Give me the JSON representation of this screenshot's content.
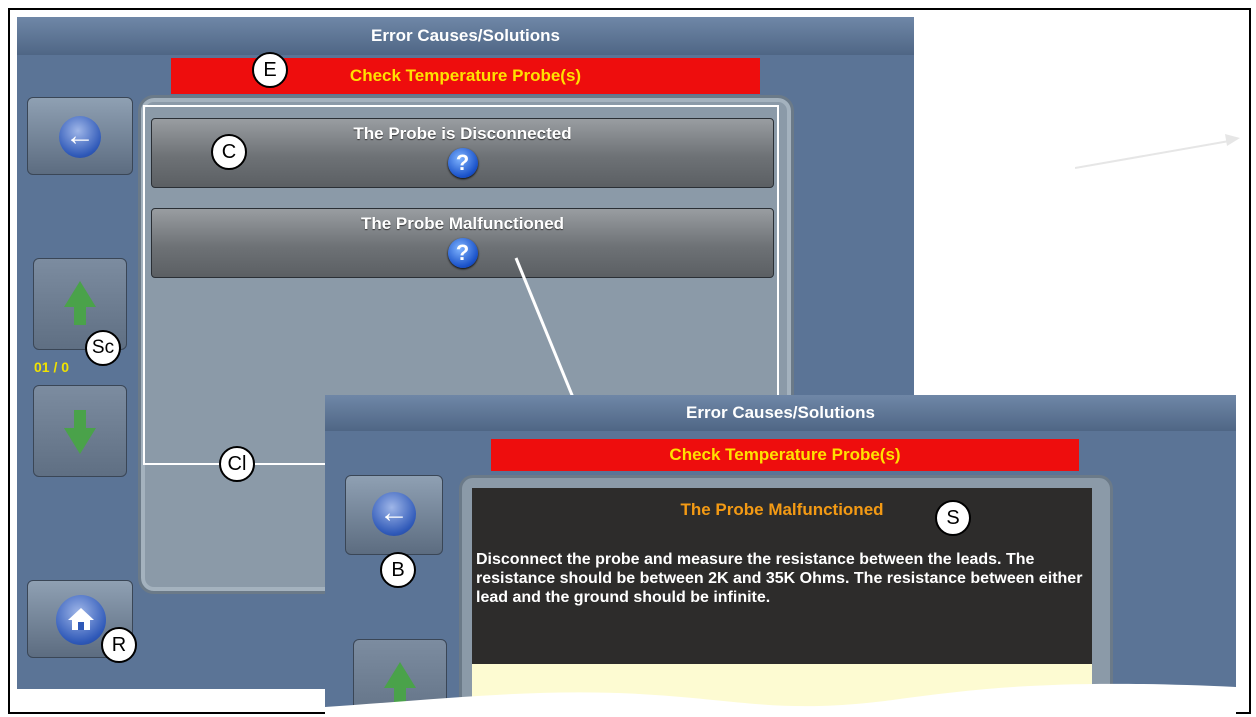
{
  "main_screen": {
    "title": "Error Causes/Solutions",
    "error_message": "Check Temperature Probe(s)",
    "causes": [
      {
        "label": "The Probe is Disconnected",
        "help_icon": "?"
      },
      {
        "label": "The Probe Malfunctioned",
        "help_icon": "?"
      }
    ],
    "pager": "01 / 0"
  },
  "inset_screen": {
    "title": "Error Causes/Solutions",
    "error_message": "Check Temperature Probe(s)",
    "solution_title": "The Probe Malfunctioned",
    "solution_text": "Disconnect the probe and measure the resistance between the leads. The resistance should be between 2K and 35K Ohms. The resistance between either lead and the ground should be infinite."
  },
  "callouts": {
    "error": "E",
    "cause": "C",
    "scroll": "Sc",
    "cause_list": "Cl",
    "return_home": "R",
    "solution": "S",
    "back": "B"
  },
  "colors": {
    "screen_bg": "#5b7496",
    "error_bar": "#ee0d0d",
    "error_text": "#ffe100",
    "solution_title": "#f39a14"
  }
}
